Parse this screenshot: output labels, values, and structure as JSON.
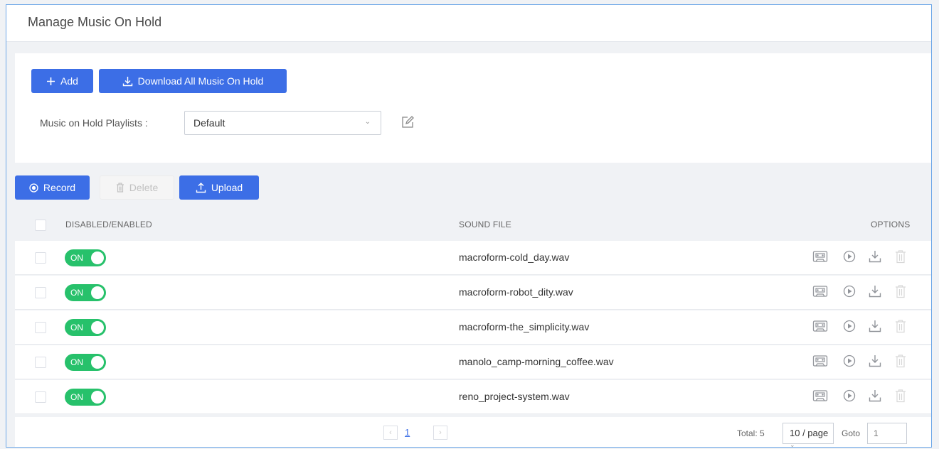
{
  "page": {
    "title": "Manage Music On Hold"
  },
  "toolbar": {
    "add_label": "Add",
    "download_all_label": "Download All Music On Hold"
  },
  "playlist": {
    "label": "Music on Hold Playlists :",
    "selected": "Default"
  },
  "actions": {
    "record_label": "Record",
    "delete_label": "Delete",
    "upload_label": "Upload"
  },
  "table": {
    "headers": {
      "enabled": "DISABLED/ENABLED",
      "sound_file": "SOUND FILE",
      "options": "OPTIONS"
    },
    "rows": [
      {
        "toggle": "ON",
        "file": "macroform-cold_day.wav"
      },
      {
        "toggle": "ON",
        "file": "macroform-robot_dity.wav"
      },
      {
        "toggle": "ON",
        "file": "macroform-the_simplicity.wav"
      },
      {
        "toggle": "ON",
        "file": "manolo_camp-morning_coffee.wav"
      },
      {
        "toggle": "ON",
        "file": "reno_project-system.wav"
      }
    ]
  },
  "pagination": {
    "current_page": "1",
    "total": "Total: 5",
    "page_size": "10 / page",
    "goto_label": "Goto",
    "goto_value": "1"
  },
  "colors": {
    "primary": "#3c6ee6",
    "toggle_on": "#27c16b",
    "border_accent": "#6fa8e8"
  },
  "icons": [
    "plus-icon",
    "download-icon",
    "edit-icon",
    "record-icon",
    "trash-icon",
    "upload-icon",
    "cassette-icon",
    "play-icon"
  ]
}
